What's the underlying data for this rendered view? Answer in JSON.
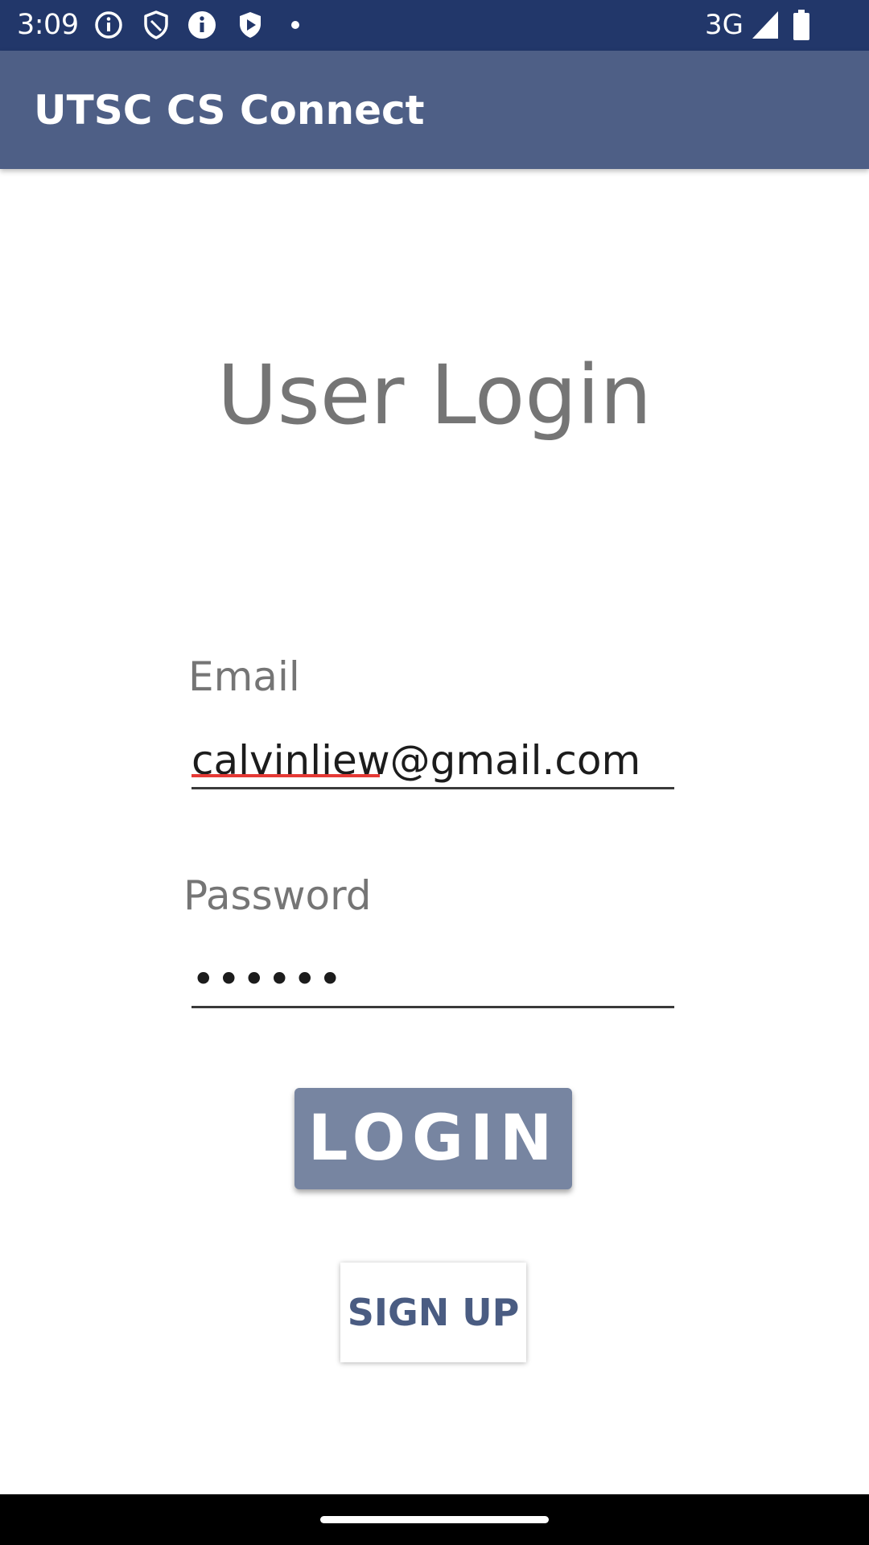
{
  "status_bar": {
    "time": "3:09",
    "network": "3G",
    "icons": [
      "info-circle-icon",
      "shield-icon",
      "info-filled-icon",
      "play-shield-icon",
      "notification-dot-icon",
      "signal-icon",
      "battery-icon"
    ]
  },
  "app_bar": {
    "title": "UTSC CS Connect"
  },
  "main": {
    "heading": "User Login",
    "email": {
      "label": "Email",
      "value": "calvinliew@gmail.com"
    },
    "password": {
      "label": "Password",
      "value": "••••••"
    },
    "login_label": "LOGIN",
    "signup_label": "SIGN UP"
  },
  "colors": {
    "status_bar": "#22376a",
    "app_bar": "#4e5f86",
    "login_button": "#7785a1",
    "signup_text": "#4a5c82",
    "spellcheck_underline": "#e53935"
  }
}
